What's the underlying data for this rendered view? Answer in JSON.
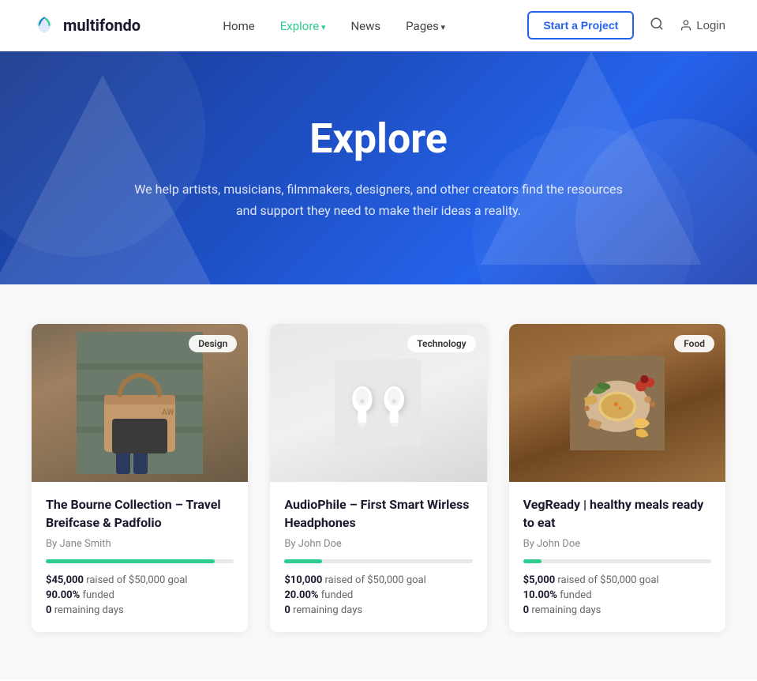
{
  "brand": {
    "name": "multifondo",
    "logo_alt": "multifondo logo"
  },
  "nav": {
    "home": "Home",
    "explore": "Explore",
    "news": "News",
    "pages": "Pages",
    "start_project": "Start a Project",
    "search_label": "Search",
    "login_label": "Login"
  },
  "hero": {
    "title": "Explore",
    "subtitle": "We help artists, musicians, filmmakers, designers, and other creators find the resources and support they need to make their ideas a reality."
  },
  "projects": [
    {
      "id": 1,
      "badge": "Design",
      "title": "The Bourne Collection – Travel Breifcase & Padfolio",
      "author": "By Jane Smith",
      "raised": "$45,000",
      "goal": "$50,000",
      "raised_label": "raised of",
      "goal_suffix": "goal",
      "funded_pct": "90.00%",
      "funded_label": "funded",
      "remaining": "0",
      "remaining_label": "remaining days",
      "progress": 90,
      "img_type": "design"
    },
    {
      "id": 2,
      "badge": "Technology",
      "title": "AudioPhile – First Smart Wirless Headphones",
      "author": "By John Doe",
      "raised": "$10,000",
      "goal": "$50,000",
      "raised_label": "raised of",
      "goal_suffix": "goal",
      "funded_pct": "20.00%",
      "funded_label": "funded",
      "remaining": "0",
      "remaining_label": "remaining days",
      "progress": 20,
      "img_type": "technology"
    },
    {
      "id": 3,
      "badge": "Food",
      "title": "VegReady | healthy meals ready to eat",
      "author": "By John Doe",
      "raised": "$5,000",
      "goal": "$50,000",
      "raised_label": "raised of",
      "goal_suffix": "goal",
      "funded_pct": "10.00%",
      "funded_label": "funded",
      "remaining": "0",
      "remaining_label": "remaining days",
      "progress": 10,
      "img_type": "food"
    }
  ]
}
